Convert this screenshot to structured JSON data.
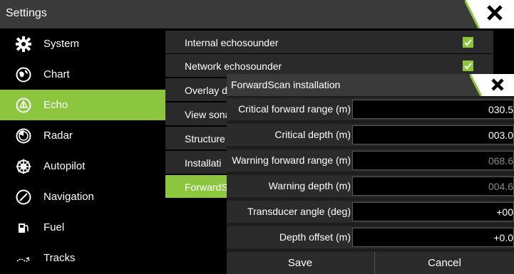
{
  "window": {
    "title": "Settings"
  },
  "sidebar": {
    "items": [
      {
        "label": "System",
        "icon": "gear-icon"
      },
      {
        "label": "Chart",
        "icon": "globe-icon"
      },
      {
        "label": "Echo",
        "icon": "echo-icon",
        "active": true
      },
      {
        "label": "Radar",
        "icon": "radar-icon"
      },
      {
        "label": "Autopilot",
        "icon": "helm-wheel-icon"
      },
      {
        "label": "Navigation",
        "icon": "compass-icon"
      },
      {
        "label": "Fuel",
        "icon": "fuel-pump-icon"
      },
      {
        "label": "Tracks",
        "icon": "tracks-icon"
      }
    ]
  },
  "options": {
    "items": [
      {
        "label": "Internal echosounder",
        "checked": true
      },
      {
        "label": "Network echosounder",
        "checked": true
      },
      {
        "label": "Overlay d"
      },
      {
        "label": "View sona"
      },
      {
        "label": "Structure"
      },
      {
        "label": "Installati"
      },
      {
        "label": "ForwardS",
        "active": true
      }
    ]
  },
  "dialog": {
    "title": "ForwardScan installation",
    "rows": [
      {
        "label": "Critical forward range (m)",
        "value": "030.5"
      },
      {
        "label": "Critical depth (m)",
        "value": "003.0"
      },
      {
        "label": "Warning forward range (m)",
        "value": "068.6",
        "dim": true
      },
      {
        "label": "Warning depth (m)",
        "value": "004.6",
        "dim": true
      },
      {
        "label": "Transducer angle (deg)",
        "value": "+00"
      },
      {
        "label": "Depth offset (m)",
        "value": "+0.0"
      }
    ],
    "save_label": "Save",
    "cancel_label": "Cancel"
  },
  "colors": {
    "accent": "#8cc63f",
    "titlebar": "#3a3a3a",
    "background": "#000000"
  }
}
